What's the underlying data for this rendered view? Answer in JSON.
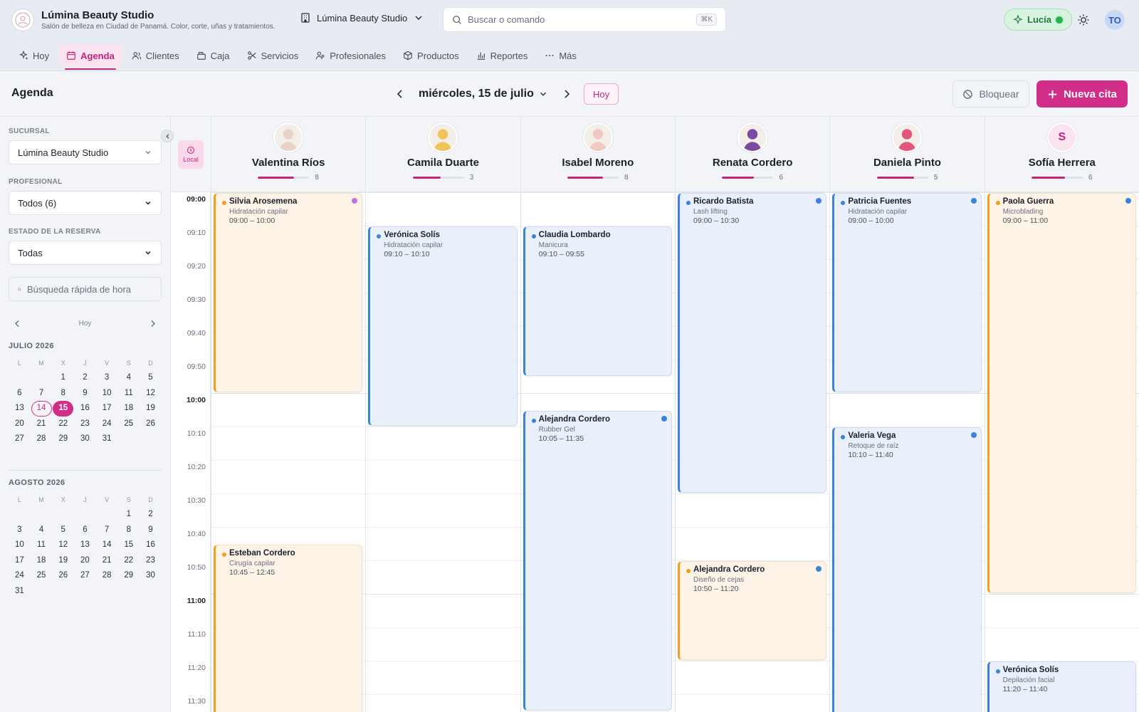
{
  "brand": {
    "title": "Lúmina Beauty Studio",
    "subtitle": "Salón de belleza en Ciudad de Panamá. Color, corte, uñas y tratamientos."
  },
  "branch": {
    "label": "Lúmina Beauty Studio"
  },
  "search": {
    "placeholder": "Buscar o comando",
    "shortcut": "⌘K"
  },
  "assistant": {
    "label": "Lucía"
  },
  "user": {
    "initials": "TO"
  },
  "nav": [
    {
      "label": "Hoy",
      "icon": "sparkles-icon"
    },
    {
      "label": "Agenda",
      "icon": "calendar-icon",
      "active": true
    },
    {
      "label": "Clientes",
      "icon": "users-icon"
    },
    {
      "label": "Caja",
      "icon": "cash-register-icon"
    },
    {
      "label": "Servicios",
      "icon": "scissors-icon"
    },
    {
      "label": "Profesionales",
      "icon": "user-group-icon"
    },
    {
      "label": "Productos",
      "icon": "box-icon"
    },
    {
      "label": "Reportes",
      "icon": "bar-chart-icon"
    },
    {
      "label": "Más",
      "icon": "more-icon"
    }
  ],
  "header": {
    "title": "Agenda",
    "date_label": "miércoles, 15 de julio",
    "today_label": "Hoy",
    "block_label": "Bloquear",
    "new_label": "Nueva cita"
  },
  "sidebar": {
    "branch_label": "SUCURSAL",
    "branch_value": "Lúmina Beauty Studio",
    "pro_label": "PROFESIONAL",
    "pro_value": "Todos (6)",
    "status_label": "ESTADO DE LA RESERVA",
    "status_value": "Todas",
    "time_search_placeholder": "Búsqueda rápida de hora",
    "cal_nav_label": "Hoy",
    "weekdays": [
      "L",
      "M",
      "X",
      "J",
      "V",
      "S",
      "D"
    ],
    "months": [
      {
        "title": "JULIO 2026",
        "offset": 2,
        "days": 31,
        "today": 14,
        "selected": 15
      },
      {
        "title": "AGOSTO 2026",
        "offset": 5,
        "days": 31
      }
    ]
  },
  "timezone": {
    "label": "Local"
  },
  "time_slots": [
    "09:00",
    "09:10",
    "09:20",
    "09:30",
    "09:40",
    "09:50",
    "10:00",
    "10:10",
    "10:20",
    "10:30",
    "10:40",
    "10:50",
    "11:00",
    "11:10",
    "11:20",
    "11:30"
  ],
  "staff": [
    {
      "name": "Valentina Ríos",
      "count": "8",
      "load": 0.7,
      "avatar_color": "#e9d3c8",
      "appointments": [
        {
          "client": "Silvia Arosemena",
          "service": "Hidratación capilar",
          "time": "09:00 – 10:00",
          "color": "orange",
          "start": 0,
          "end": 60,
          "corner": "#c56de0"
        },
        {
          "client": "Esteban Cordero",
          "service": "Cirugía capilar",
          "time": "10:45 – 12:45",
          "color": "orange",
          "start": 105,
          "end": 225
        }
      ]
    },
    {
      "name": "Camila Duarte",
      "count": "3",
      "load": 0.55,
      "avatar_color": "#f0c45a",
      "appointments": [
        {
          "client": "Verónica Solís",
          "service": "Hidratación capilar",
          "time": "09:10 – 10:10",
          "color": "blue",
          "start": 10,
          "end": 70
        }
      ]
    },
    {
      "name": "Isabel Moreno",
      "count": "8",
      "load": 0.7,
      "avatar_color": "#f1c9c2",
      "appointments": [
        {
          "client": "Claudia Lombardo",
          "service": "Manicura",
          "time": "09:10 – 09:55",
          "color": "blue",
          "start": 10,
          "end": 55
        },
        {
          "client": "Alejandra Cordero",
          "service": "Rubber Gel",
          "time": "10:05 – 11:35",
          "color": "blue",
          "start": 65,
          "end": 155,
          "corner": "#3b82dd"
        }
      ]
    },
    {
      "name": "Renata Cordero",
      "count": "6",
      "load": 0.62,
      "avatar_color": "#7a4aa0",
      "appointments": [
        {
          "client": "Ricardo Batista",
          "service": "Lash lifting",
          "time": "09:00 – 10:30",
          "color": "blue",
          "start": 0,
          "end": 90,
          "corner": "#3b82dd"
        },
        {
          "client": "Alejandra Cordero",
          "service": "Diseño de cejas",
          "time": "10:50 – 11:20",
          "color": "orange",
          "start": 110,
          "end": 140,
          "corner": "#3b82dd"
        }
      ]
    },
    {
      "name": "Daniela Pinto",
      "count": "5",
      "load": 0.72,
      "avatar_color": "#e3557a",
      "appointments": [
        {
          "client": "Patricia Fuentes",
          "service": "Hidratación capilar",
          "time": "09:00 – 10:00",
          "color": "blue",
          "start": 0,
          "end": 60,
          "corner": "#3b82dd"
        },
        {
          "client": "Valeria Vega",
          "service": "Retoque de raíz",
          "time": "10:10 – 11:40",
          "color": "blue",
          "start": 70,
          "end": 160,
          "corner": "#3b82dd"
        }
      ]
    },
    {
      "name": "Sofía Herrera",
      "count": "6",
      "load": 0.65,
      "initial": "S",
      "appointments": [
        {
          "client": "Paola Guerra",
          "service": "Microblading",
          "time": "09:00 – 11:00",
          "color": "orange",
          "start": 0,
          "end": 120,
          "corner": "#3b82dd"
        },
        {
          "client": "Verónica Solís",
          "service": "Depilación facial",
          "time": "11:20 – 11:40",
          "color": "blue",
          "start": 140,
          "end": 160
        }
      ]
    }
  ],
  "colors": {
    "accent": "#d02e89",
    "orange": "#f0a020",
    "blue": "#3b82dd",
    "success": "#22b64a"
  }
}
